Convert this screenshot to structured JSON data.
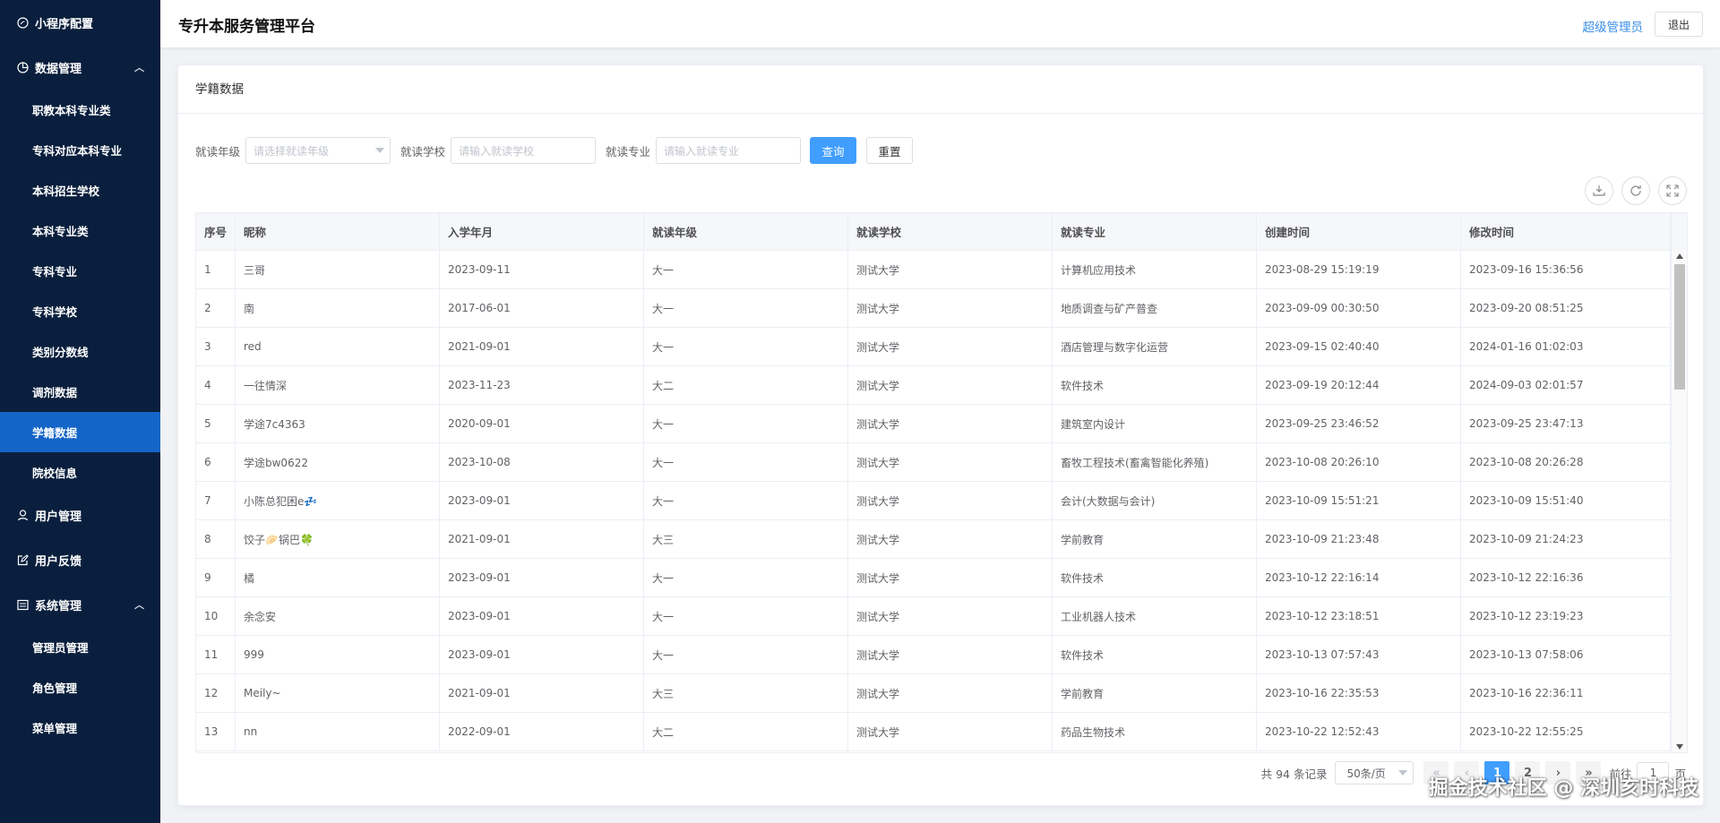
{
  "sidebar": {
    "items": [
      {
        "type": "group",
        "label": "小程序配置",
        "icon": "mini-program-icon",
        "chevron": ""
      },
      {
        "type": "group",
        "label": "数据管理",
        "icon": "pie-chart-icon",
        "chevron": "︿"
      },
      {
        "type": "item",
        "label": "职教本科专业类"
      },
      {
        "type": "item",
        "label": "专科对应本科专业"
      },
      {
        "type": "item",
        "label": "本科招生学校"
      },
      {
        "type": "item",
        "label": "本科专业类"
      },
      {
        "type": "item",
        "label": "专科专业"
      },
      {
        "type": "item",
        "label": "专科学校"
      },
      {
        "type": "item",
        "label": "类别分数线"
      },
      {
        "type": "item",
        "label": "调剂数据"
      },
      {
        "type": "item",
        "label": "学籍数据",
        "active": true
      },
      {
        "type": "item",
        "label": "院校信息"
      },
      {
        "type": "group",
        "label": "用户管理",
        "icon": "user-icon",
        "chevron": ""
      },
      {
        "type": "group",
        "label": "用户反馈",
        "icon": "edit-icon",
        "chevron": ""
      },
      {
        "type": "group",
        "label": "系统管理",
        "icon": "settings-panel-icon",
        "chevron": "︿"
      },
      {
        "type": "item",
        "label": "管理员管理"
      },
      {
        "type": "item",
        "label": "角色管理"
      },
      {
        "type": "item",
        "label": "菜单管理"
      }
    ]
  },
  "header": {
    "title": "专升本服务管理平台",
    "admin": "超级管理员",
    "logout": "退出"
  },
  "card": {
    "title": "学籍数据"
  },
  "filter": {
    "grade_label": "就读年级",
    "grade_placeholder": "请选择就读年级",
    "school_label": "就读学校",
    "school_placeholder": "请输入就读学校",
    "major_label": "就读专业",
    "major_placeholder": "请输入就读专业",
    "query": "查询",
    "reset": "重置"
  },
  "tools": [
    "download-icon",
    "refresh-icon",
    "fullscreen-icon"
  ],
  "table": {
    "columns": [
      "序号",
      "昵称",
      "入学年月",
      "就读年级",
      "就读学校",
      "就读专业",
      "创建时间",
      "修改时间"
    ],
    "rows": [
      [
        "1",
        "三哥",
        "2023-09-11",
        "大一",
        "测试大学",
        "计算机应用技术",
        "2023-08-29 15:19:19",
        "2023-09-16 15:36:56"
      ],
      [
        "2",
        "南",
        "2017-06-01",
        "大一",
        "测试大学",
        "地质调查与矿产普查",
        "2023-09-09 00:30:50",
        "2023-09-20 08:51:25"
      ],
      [
        "3",
        "red",
        "2021-09-01",
        "大一",
        "测试大学",
        "酒店管理与数字化运营",
        "2023-09-15 02:40:40",
        "2024-01-16 01:02:03"
      ],
      [
        "4",
        "一往情深",
        "2023-11-23",
        "大二",
        "测试大学",
        "软件技术",
        "2023-09-19 20:12:44",
        "2024-09-03 02:01:57"
      ],
      [
        "5",
        "学途7c4363",
        "2020-09-01",
        "大一",
        "测试大学",
        "建筑室内设计",
        "2023-09-25 23:46:52",
        "2023-09-25 23:47:13"
      ],
      [
        "6",
        "学途bw0622",
        "2023-10-08",
        "大一",
        "测试大学",
        "畜牧工程技术(畜禽智能化养殖)",
        "2023-10-08 20:26:10",
        "2023-10-08 20:26:28"
      ],
      [
        "7",
        "小陈总犯困e💤",
        "2023-09-01",
        "大一",
        "测试大学",
        "会计(大数据与会计)",
        "2023-10-09 15:51:21",
        "2023-10-09 15:51:40"
      ],
      [
        "8",
        "饺子🥟锅巴🍀",
        "2021-09-01",
        "大三",
        "测试大学",
        "学前教育",
        "2023-10-09 21:23:48",
        "2023-10-09 21:24:23"
      ],
      [
        "9",
        "橘",
        "2023-09-01",
        "大一",
        "测试大学",
        "软件技术",
        "2023-10-12 22:16:14",
        "2023-10-12 22:16:36"
      ],
      [
        "10",
        "余念安",
        "2023-09-01",
        "大一",
        "测试大学",
        "工业机器人技术",
        "2023-10-12 23:18:51",
        "2023-10-12 23:19:23"
      ],
      [
        "11",
        "999",
        "2023-09-01",
        "大一",
        "测试大学",
        "软件技术",
        "2023-10-13 07:57:43",
        "2023-10-13 07:58:06"
      ],
      [
        "12",
        "Meily~",
        "2021-09-01",
        "大三",
        "测试大学",
        "学前教育",
        "2023-10-16 22:35:53",
        "2023-10-16 22:36:11"
      ],
      [
        "13",
        "nn",
        "2022-09-01",
        "大二",
        "测试大学",
        "药品生物技术",
        "2023-10-22 12:52:43",
        "2023-10-22 12:55:25"
      ]
    ]
  },
  "pager": {
    "total": "共 94 条记录",
    "size": "50条/页",
    "first": "«",
    "prev": "‹",
    "pages": [
      "1",
      "2"
    ],
    "active_page": "1",
    "next": "›",
    "last": "»",
    "goto_label": "前往",
    "goto_value": "1",
    "goto_unit": "页"
  },
  "watermark": "掘金技术社区 @ 深圳亥时科技"
}
